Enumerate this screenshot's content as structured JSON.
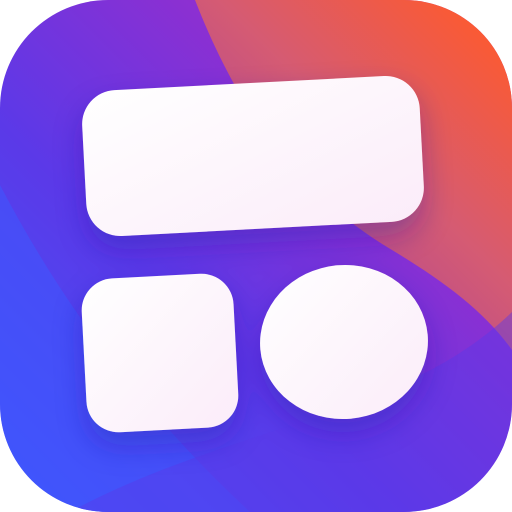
{
  "app_icon": {
    "name": "widget-layout-app-icon",
    "background_colors": {
      "blue": "#3f57fb",
      "indigo": "#5b39e8",
      "purple": "#8f2fd0",
      "magenta": "#c43fae",
      "orange": "#ff5a2c",
      "rose": "#d55b73",
      "plum": "#9c3ba4"
    },
    "tile_colors": {
      "light": "#ffffff",
      "tint": "#fbecf9"
    }
  }
}
